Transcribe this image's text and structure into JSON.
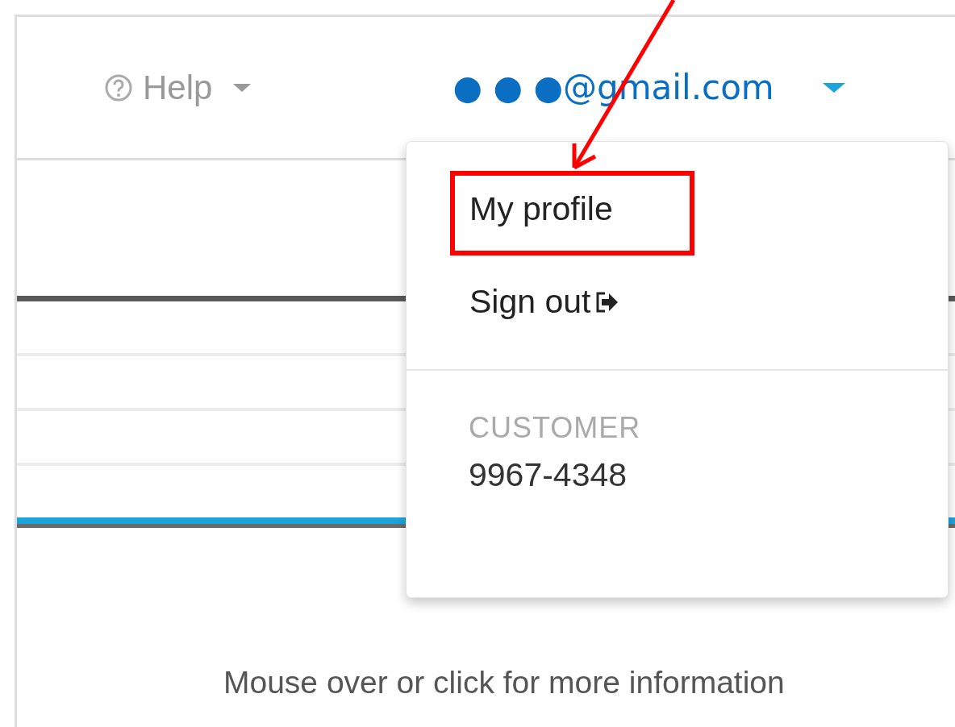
{
  "header": {
    "help": {
      "label": "Help"
    },
    "account": {
      "email": "● ● ●@gmail.com",
      "expanded": true
    }
  },
  "account_menu": {
    "items": [
      {
        "kind": "link",
        "label": "My profile",
        "highlighted": true
      },
      {
        "kind": "signout",
        "label": "Sign out",
        "highlighted": false
      }
    ],
    "customer": {
      "label": "CUSTOMER",
      "number": "9967-4348"
    }
  },
  "hint": "Mouse over or click for more information"
}
